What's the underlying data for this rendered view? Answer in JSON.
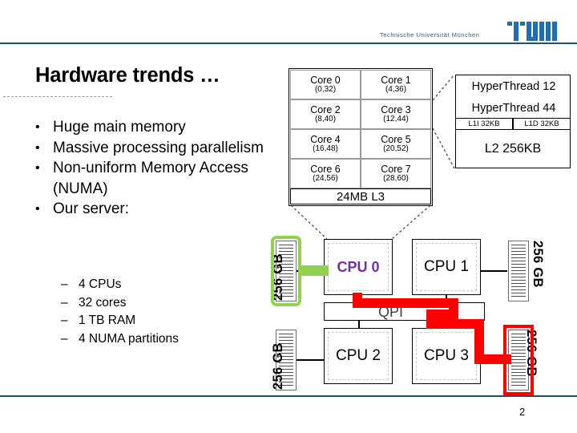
{
  "header": {
    "university": "Technische Universität München",
    "logo_name": "tum-logo",
    "rule_color": "#1f5167"
  },
  "slide": {
    "title": "Hardware trends …",
    "page_number": "2",
    "bullets": [
      {
        "marker": "•",
        "text": "Huge main memory"
      },
      {
        "marker": "•",
        "text": "Massive processing parallelism"
      },
      {
        "marker": "•",
        "text": "Non-uniform Memory Access (NUMA)"
      },
      {
        "marker": "•",
        "text": "Our server:"
      }
    ],
    "sub_bullets": [
      {
        "marker": "–",
        "text": "4 CPUs"
      },
      {
        "marker": "–",
        "text": "32 cores"
      },
      {
        "marker": "–",
        "text": "1 TB RAM"
      },
      {
        "marker": "–",
        "text": "4 NUMA partitions"
      }
    ]
  },
  "diagram": {
    "cores": [
      {
        "name": "Core 0",
        "ids": "(0,32)"
      },
      {
        "name": "Core 1",
        "ids": "(4,36)"
      },
      {
        "name": "Core 2",
        "ids": "(8,40)"
      },
      {
        "name": "Core 3",
        "ids": "(12,44)"
      },
      {
        "name": "Core 4",
        "ids": "(16,48)"
      },
      {
        "name": "Core 5",
        "ids": "(20,52)"
      },
      {
        "name": "Core 6",
        "ids": "(24,56)"
      },
      {
        "name": "Core 7",
        "ids": "(28,60)"
      }
    ],
    "l3_cache": "24MB L3",
    "hyperthreads": [
      "HyperThread 12",
      "HyperThread 44"
    ],
    "l1_caches": [
      "L1I 32KB",
      "L1D 32KB"
    ],
    "l2_cache": "L2 256KB",
    "cpus": [
      {
        "label": "CPU 0",
        "highlighted": true
      },
      {
        "label": "CPU 1",
        "highlighted": false
      },
      {
        "label": "CPU 2",
        "highlighted": false
      },
      {
        "label": "CPU 3",
        "highlighted": false
      }
    ],
    "interconnect": "QPI",
    "memory_banks": [
      {
        "label": "256 GB",
        "position": "top-left",
        "highlight": "green"
      },
      {
        "label": "256 GB",
        "position": "top-right",
        "highlight": "none"
      },
      {
        "label": "256 GB",
        "position": "bottom-left",
        "highlight": "none"
      },
      {
        "label": "256 GB",
        "position": "bottom-right",
        "highlight": "red"
      }
    ],
    "colors": {
      "local_access": "#92d050",
      "remote_access": "#ff0000",
      "cpu_highlight": "#7030a0"
    }
  }
}
